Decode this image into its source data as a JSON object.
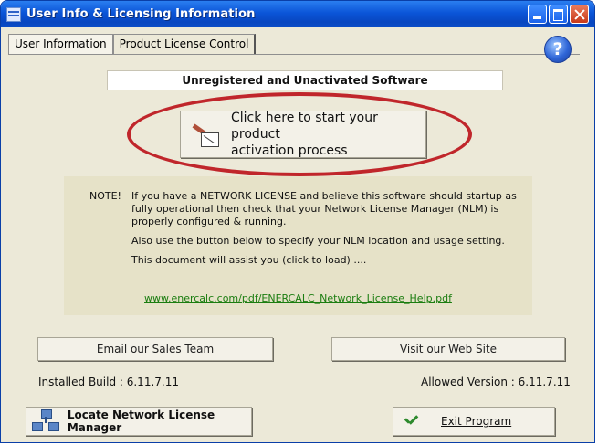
{
  "window": {
    "title": "User Info & Licensing Information"
  },
  "tabs": [
    {
      "label": "User Information"
    },
    {
      "label": "Product License Control"
    }
  ],
  "status_text": "Unregistered and Unactivated Software",
  "activation_button": {
    "line1": "Click here to start your product",
    "line2": "activation process"
  },
  "note": {
    "label": "NOTE!",
    "paragraphs": [
      "If you have a NETWORK LICENSE and believe this software should startup as fully operational then check that your Network License Manager (NLM) is properly configured & running.",
      "Also use the button below to specify your NLM location and usage setting.",
      "This document will assist you (click to load) ...."
    ],
    "link": "www.enercalc.com/pdf/ENERCALC_Network_License_Help.pdf"
  },
  "buttons": {
    "email": "Email our Sales Team",
    "website": "Visit our Web Site",
    "locate": "Locate Network License Manager",
    "exit": "Exit Program"
  },
  "build_info": {
    "installed": "Installed Build : 6.11.7.11",
    "allowed": "Allowed Version : 6.11.7.11"
  },
  "colors": {
    "accent_red": "#c0262b",
    "link_green": "#1b7d10",
    "titlebar_blue": "#0b55d8"
  }
}
